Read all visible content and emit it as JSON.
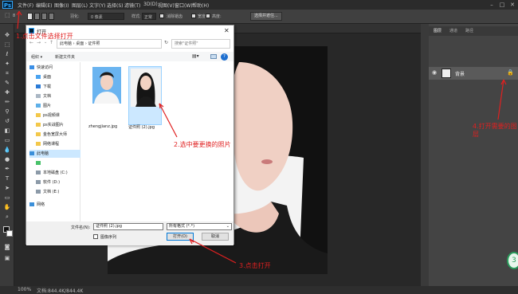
{
  "app": {
    "logo": "Ps",
    "menu": [
      "文件(F)",
      "编辑(E)",
      "图像(I)",
      "图层(L)",
      "文字(Y)",
      "选择(S)",
      "滤镜(T)",
      "3D(D)",
      "视图(V)",
      "窗口(W)",
      "帮助(H)"
    ]
  },
  "options_bar": {
    "tool_size": "8",
    "feather_label": "羽化:",
    "feather_value": "0 像素",
    "antialias_label": "消除锯齿",
    "style_label": "样式:",
    "style_value": "正常",
    "width_label": "宽度:",
    "height_label": "高度:",
    "select_mask_button": "选择并遮住..."
  },
  "status_bar": {
    "zoom": "100%",
    "doc_info": "文档:844.4K/844.4K"
  },
  "right_panel": {
    "tabs": [
      "图层",
      "通道",
      "路径"
    ],
    "layer_name": "背景"
  },
  "dialog": {
    "title": "打开",
    "breadcrumb": [
      "此电脑",
      "桌面",
      "证件照"
    ],
    "search_placeholder": "搜索\"证件照\"",
    "organize": "组织 ▾",
    "new_folder": "新建文件夹",
    "nav": {
      "quick_access": "快速访问",
      "items": [
        "桌面",
        "下载",
        "文档",
        "图片",
        "ps视频课",
        "ps实战图片",
        "金色宽屏大师",
        "网络课程"
      ],
      "this_pc": "此电脑",
      "drives": [
        "本地磁盘 (C:)",
        "软件 (D:)",
        "文档 (E:)"
      ],
      "network": "网络"
    },
    "files": [
      {
        "name": "zhengjianz.jpg"
      },
      {
        "name": "证件照 (2).jpg",
        "selected": true
      }
    ],
    "filename_label": "文件名(N):",
    "filename_value": "证件照 (2).jpg",
    "filetype_value": "所有格式 (*.*)",
    "sequence_label": "图像序列",
    "open_button": "打开(O)",
    "cancel_button": "取消"
  },
  "annotations": {
    "step1": "1.点击文件选择打开",
    "step2": "2.选中要更换的照片",
    "step3": "3.点击打开",
    "step4": "4.打开需要的图层"
  },
  "colors": {
    "annotation": "#e02020",
    "selection": "#cce8ff",
    "ps_dark": "#2b2b2b"
  }
}
